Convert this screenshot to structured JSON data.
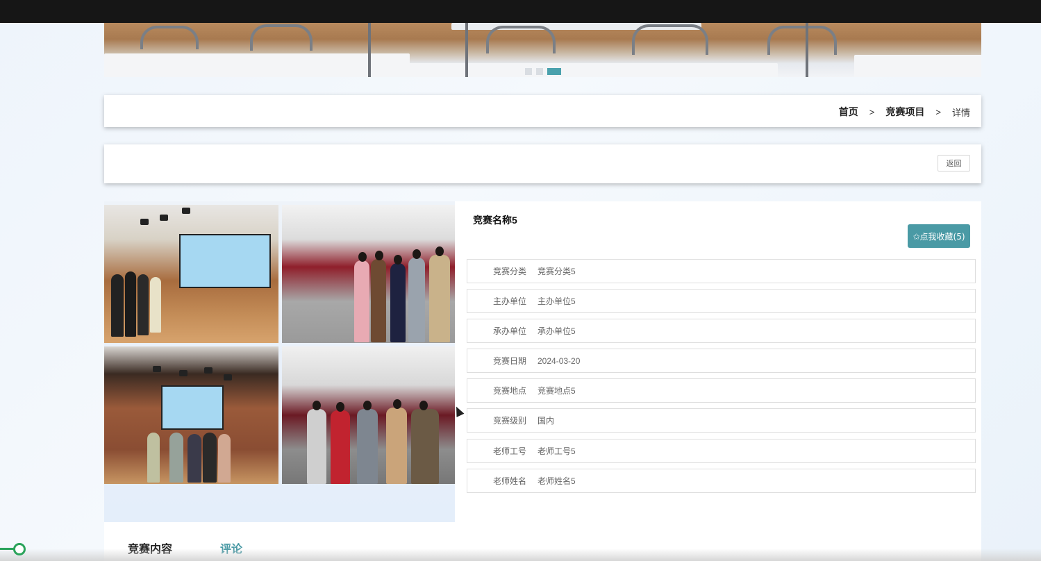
{
  "breadcrumb": {
    "home": "首页",
    "section": "竞赛项目",
    "current": "详情",
    "separator": ">"
  },
  "back_button": "返回",
  "competition": {
    "title": "竞赛名称5",
    "favorite_button": "✩点我收藏(5)",
    "fields": [
      {
        "label": "竞赛分类",
        "value": "竞赛分类5"
      },
      {
        "label": "主办单位",
        "value": "主办单位5"
      },
      {
        "label": "承办单位",
        "value": "承办单位5"
      },
      {
        "label": "竞赛日期",
        "value": "2024-03-20"
      },
      {
        "label": "竞赛地点",
        "value": "竞赛地点5"
      },
      {
        "label": "竞赛级别",
        "value": "国内"
      },
      {
        "label": "老师工号",
        "value": "老师工号5"
      },
      {
        "label": "老师姓名",
        "value": "老师姓名5"
      }
    ]
  },
  "tabs": {
    "content": "竞赛内容",
    "comments": "评论"
  },
  "colors": {
    "accent": "#4a9aa5",
    "topbar": "#161616",
    "progress": "#2aa35b"
  }
}
